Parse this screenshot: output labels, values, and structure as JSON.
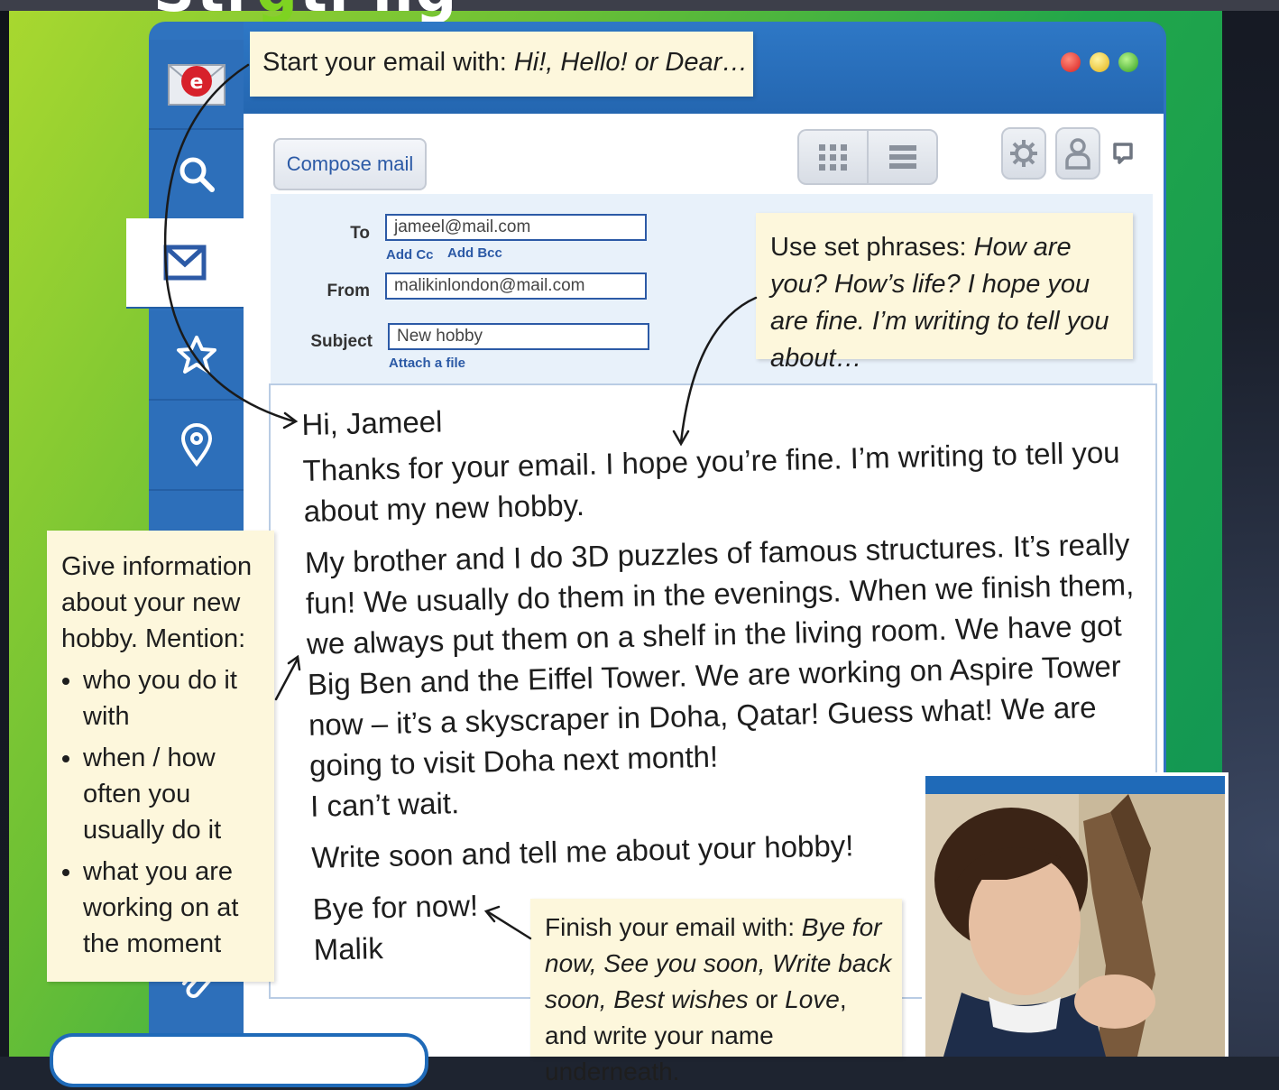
{
  "title_fragment": {
    "part1": "Str",
    "accent": "g",
    "part2": "ti ng"
  },
  "toolbar": {
    "compose_label": "Compose mail"
  },
  "fields": {
    "to_label": "To",
    "to_value": "jameel@mail.com",
    "add_cc": "Add Cc",
    "add_bcc": "Add Bcc",
    "from_label": "From",
    "from_value": "malikinlondon@mail.com",
    "subject_label": "Subject",
    "subject_value": "New hobby",
    "attach": "Attach a file"
  },
  "email": {
    "greeting": "Hi, Jameel",
    "p1": "Thanks for your email. I hope you’re fine. I’m writing to tell you about my new hobby.",
    "p2": "My brother and I do 3D puzzles of famous structures. It’s really fun! We usually do them in the evenings. When we finish them, we always put them on a shelf in the living room. We have got Big Ben and the Eiffel Tower. We are working on Aspire Tower now – it’s a skyscraper in Doha, Qatar! Guess what! We are going to visit Doha next month!",
    "p2b": "I can’t wait.",
    "p3": "Write soon and tell me about your hobby!",
    "signoff": "Bye for now!",
    "name": "Malik"
  },
  "notes": {
    "start": {
      "text": "Start your email with: ",
      "phrases": "Hi!, Hello! or Dear…"
    },
    "phrases": {
      "lead": "Use set phrases: ",
      "text": "How are you? How’s life? I hope you are fine. I’m writing to tell you about…"
    },
    "info": {
      "lead": "Give information about your new hobby. Mention:",
      "bullets": [
        "who you do it with",
        "when / how often you usually do it",
        "what you are working on at the moment"
      ]
    },
    "finish": {
      "lead": "Finish your email with: ",
      "p1": "Bye for now, See you soon, Write back soon, Best wishes",
      "or": " or ",
      "p2": "Love",
      "tail": ", and write your name underneath."
    }
  },
  "icons": [
    "email-app-icon",
    "search-icon",
    "mail-icon",
    "star-icon",
    "location-pin-icon",
    "paperclip-icon",
    "grid-view-icon",
    "list-view-icon",
    "gear-icon",
    "user-icon",
    "chat-icon"
  ],
  "colors": {
    "accent_blue": "#2f73bf",
    "note_bg": "#fdf7dc",
    "green": "#21a64a"
  }
}
